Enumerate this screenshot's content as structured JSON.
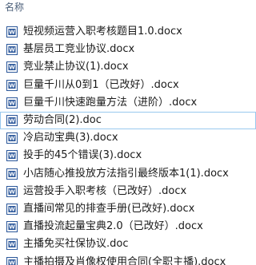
{
  "header": {
    "column_name_label": "名称"
  },
  "icons": {
    "doc_icon": "word-document-icon",
    "blue": "#2b579a",
    "light_blue": "#dbe7f5"
  },
  "files": [
    {
      "name": "短视频运营入职考核题目1.0.docx"
    },
    {
      "name": "基层员工竞业协议.docx"
    },
    {
      "name": "竞业禁止协议(1).docx"
    },
    {
      "name": "巨量千川从0到1（已改好）.docx"
    },
    {
      "name": "巨量千川快速跑量方法（进阶）.docx"
    },
    {
      "name": "劳动合同(2).doc",
      "selected": true
    },
    {
      "name": "冷启动宝典(3).docx"
    },
    {
      "name": "投手的45个错误(3).docx"
    },
    {
      "name": "小店随心推投放方法指引最终版本1(1).docx"
    },
    {
      "name": "运营投手入职考核（已改好）.docx"
    },
    {
      "name": "直播间常见的排查手册(已改好).docx"
    },
    {
      "name": "直播投流起量宝典2.0（已改好）.docx"
    },
    {
      "name": "主播免买社保协议.doc"
    },
    {
      "name": "主播拍摄及肖像权使用合同(全职主播).docx"
    }
  ]
}
